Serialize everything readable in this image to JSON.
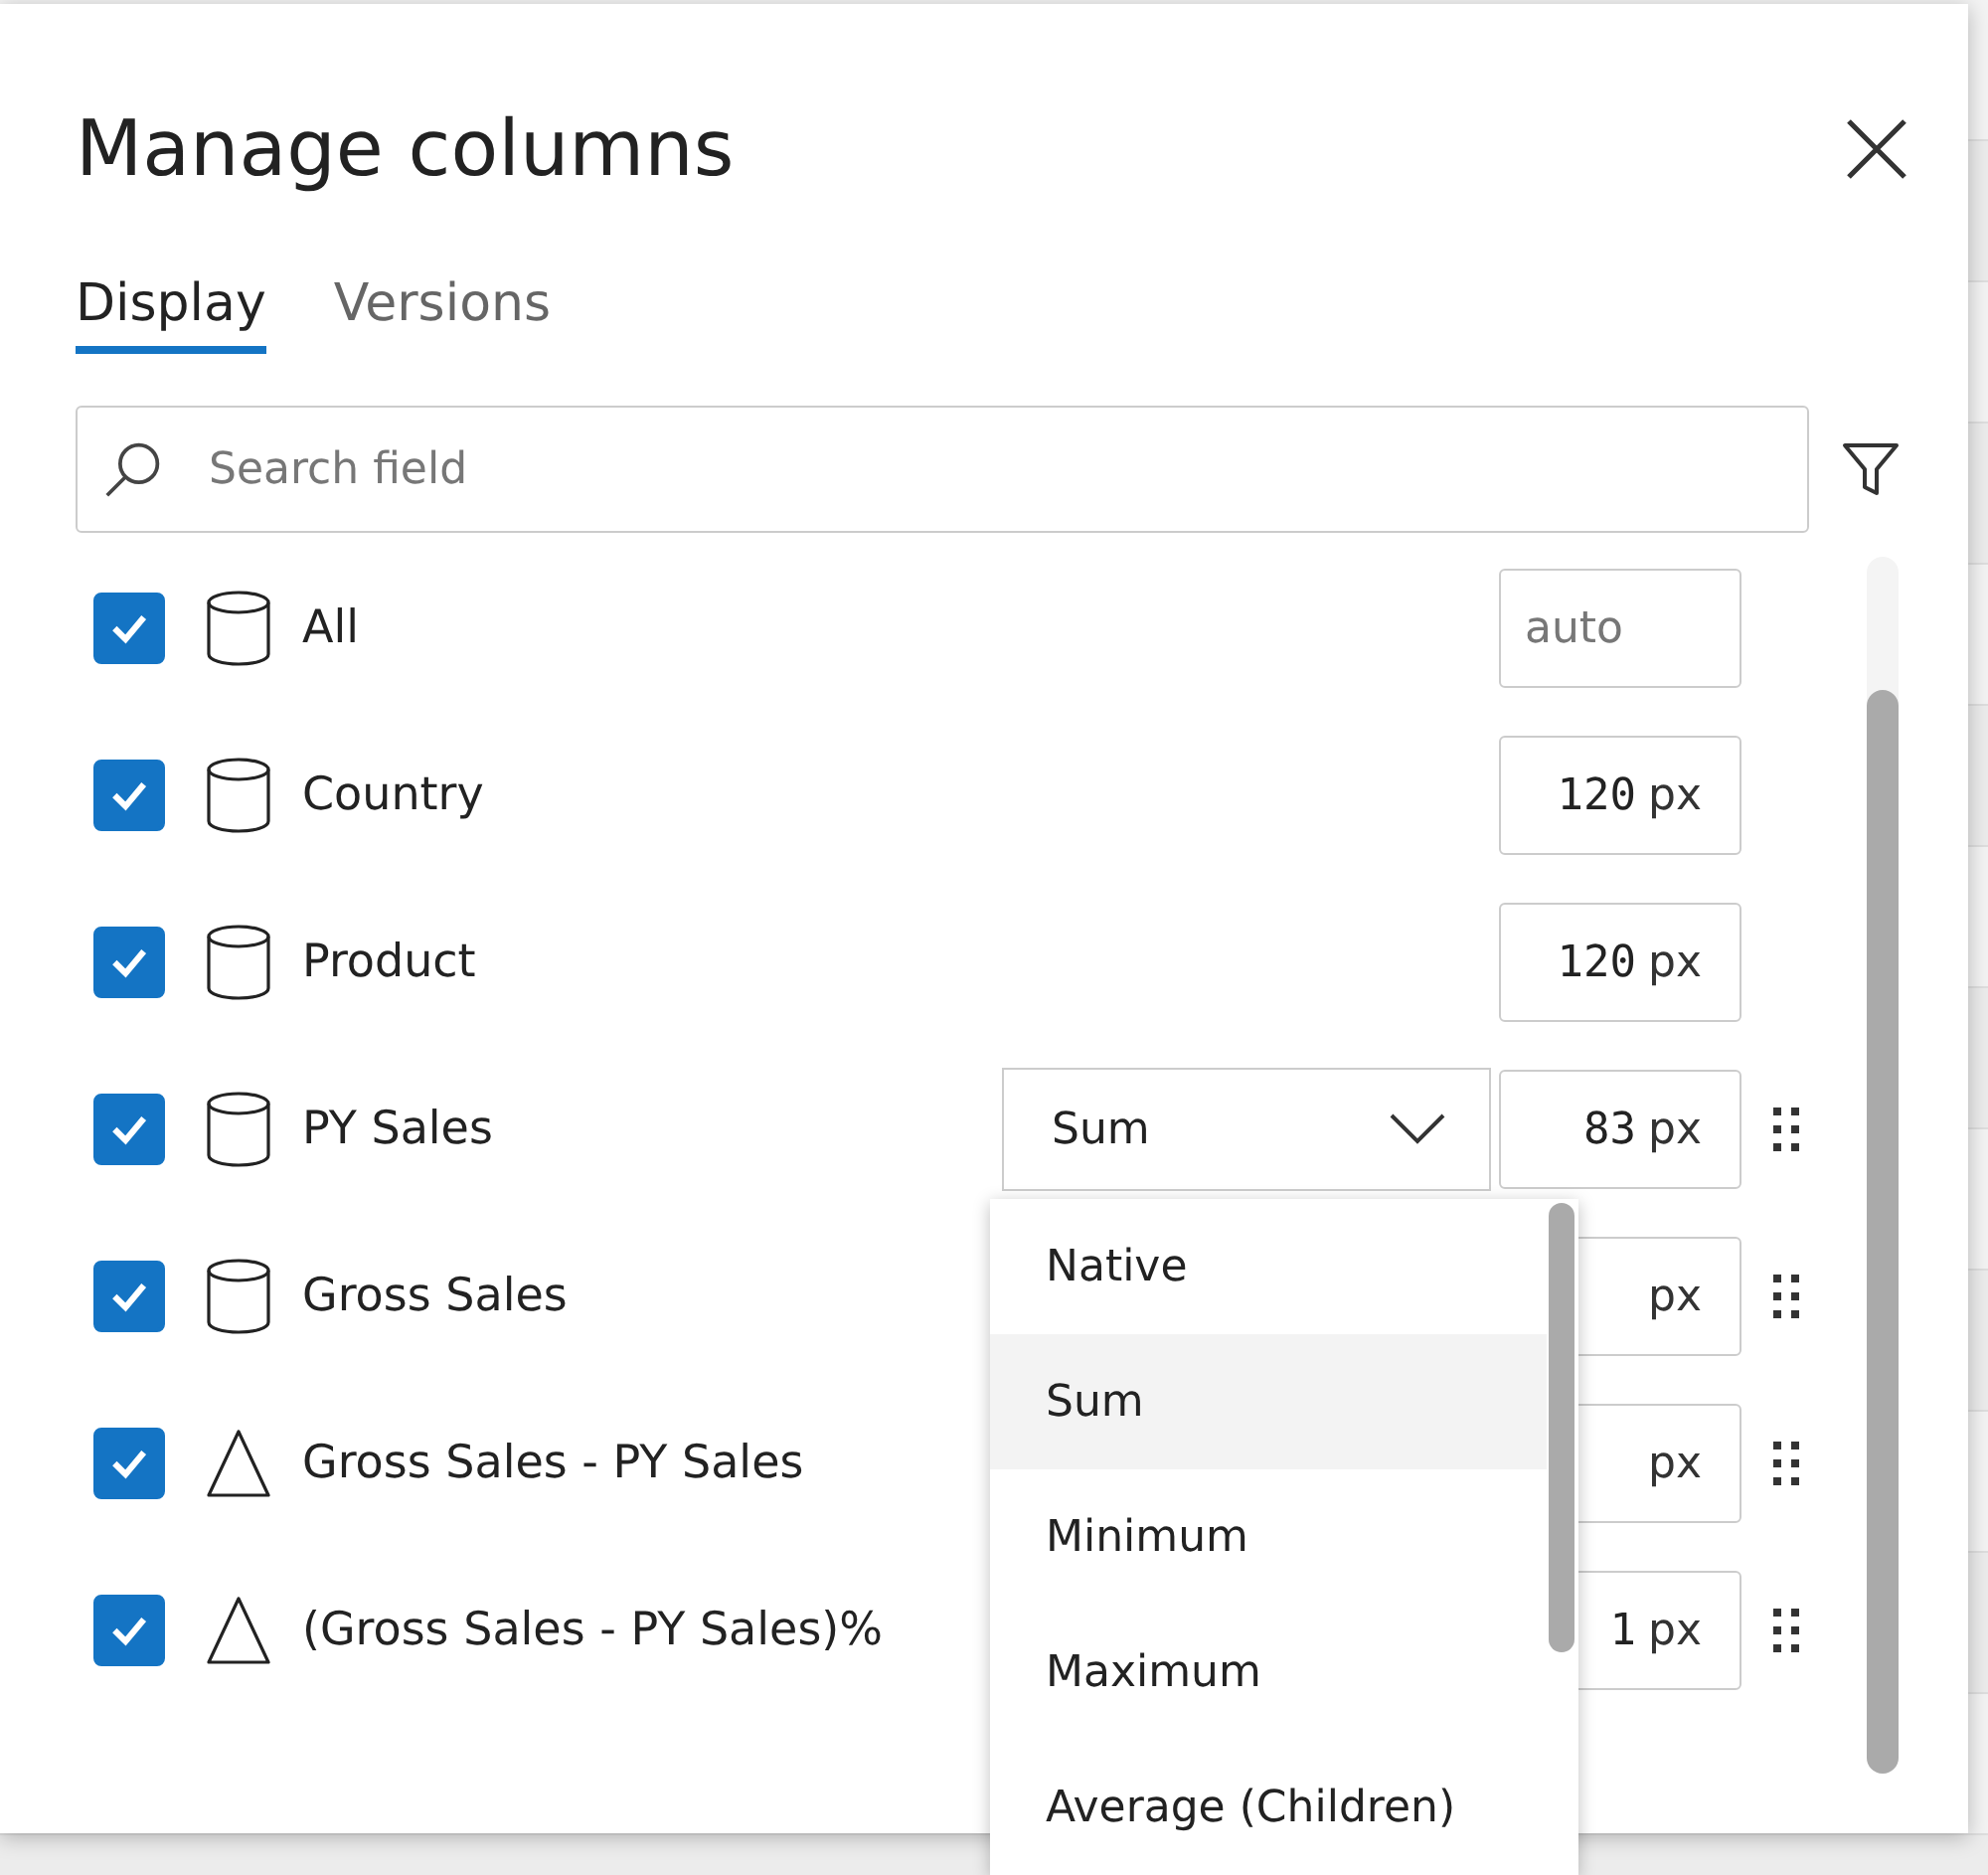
{
  "dialog": {
    "title": "Manage columns",
    "tabs": [
      {
        "label": "Display",
        "selected": true
      },
      {
        "label": "Versions",
        "selected": false
      }
    ],
    "search": {
      "placeholder": "Search field"
    },
    "rows": [
      {
        "kind": "field",
        "label": "All",
        "checked": true,
        "width": {
          "placeholder": "auto"
        },
        "draggable": false
      },
      {
        "kind": "field",
        "label": "Country",
        "checked": true,
        "width": {
          "value": "120",
          "unit": "px"
        },
        "draggable": false
      },
      {
        "kind": "field",
        "label": "Product",
        "checked": true,
        "width": {
          "value": "120",
          "unit": "px"
        },
        "draggable": false
      },
      {
        "kind": "field",
        "label": "PY Sales",
        "checked": true,
        "aggregation": {
          "value": "Sum",
          "expanded": true
        },
        "width": {
          "value": "83",
          "unit": "px"
        },
        "draggable": true
      },
      {
        "kind": "field",
        "label": "Gross Sales",
        "checked": true,
        "width": {
          "unit": "px"
        },
        "draggable": true
      },
      {
        "kind": "calculated",
        "label": "Gross Sales - PY Sales",
        "checked": true,
        "width": {
          "unit": "px"
        },
        "draggable": true
      },
      {
        "kind": "calculated",
        "label": "(Gross Sales - PY Sales)%",
        "checked": true,
        "width": {
          "value": "1",
          "unit": "px"
        },
        "draggable": true
      }
    ],
    "dropdown": {
      "options": [
        {
          "label": "Native",
          "selected": false
        },
        {
          "label": "Sum",
          "selected": true
        },
        {
          "label": "Minimum",
          "selected": false
        },
        {
          "label": "Maximum",
          "selected": false
        },
        {
          "label": "Average (Children)",
          "selected": false
        }
      ]
    }
  }
}
